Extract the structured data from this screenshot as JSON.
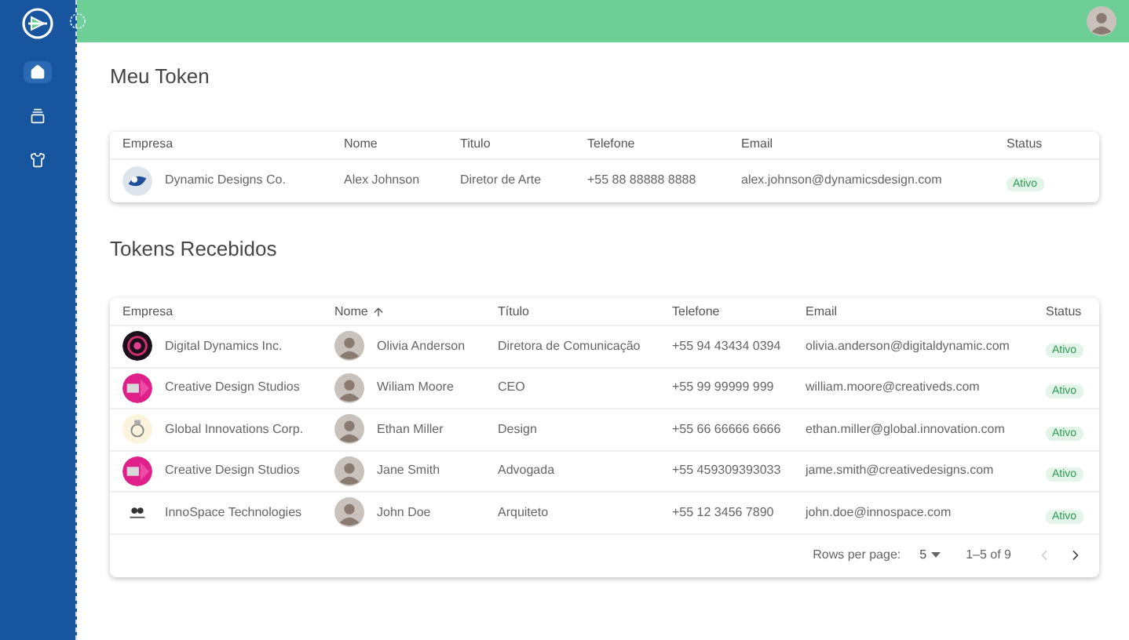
{
  "sidebar": {
    "items": [
      {
        "kind": "home",
        "selected": true
      },
      {
        "kind": "cards",
        "selected": false
      },
      {
        "kind": "shirt",
        "selected": false
      }
    ]
  },
  "my_token": {
    "title": "Meu Token",
    "columns": [
      "Empresa",
      "Nome",
      "Titulo",
      "Telefone",
      "Email",
      "Status"
    ],
    "rows": [
      {
        "company": "Dynamic Designs Co.",
        "name": "Alex Johnson",
        "title": "Diretor de Arte",
        "phone": "+55 88 88888 8888",
        "email": "alex.johnson@dynamicsdesign.com",
        "status": "Ativo"
      }
    ]
  },
  "received_tokens": {
    "title": "Tokens Recebidos",
    "columns": [
      {
        "label": "Empresa",
        "sorted": false
      },
      {
        "label": "Nome",
        "sorted": true
      },
      {
        "label": "Título",
        "sorted": false
      },
      {
        "label": "Telefone",
        "sorted": false
      },
      {
        "label": "Email",
        "sorted": false
      },
      {
        "label": "Status",
        "sorted": false
      }
    ],
    "rows": [
      {
        "company": "Digital Dynamics Inc.",
        "name": "Olivia Anderson",
        "title": "Diretora de Comunicação",
        "phone": "+55 94 43434 0394",
        "email": "olivia.anderson@digitaldynamic.com",
        "status": "Ativo"
      },
      {
        "company": "Creative Design Studios",
        "name": "Wiliam Moore",
        "title": "CEO",
        "phone": "+55 99 99999 999",
        "email": "william.moore@creativeds.com",
        "status": "Ativo"
      },
      {
        "company": "Global Innovations Corp.",
        "name": "Ethan Miller",
        "title": "Design",
        "phone": "+55 66 66666 6666",
        "email": "ethan.miller@global.innovation.com",
        "status": "Ativo"
      },
      {
        "company": "Creative Design Studios",
        "name": "Jane Smith",
        "title": "Advogada",
        "phone": "+55 459309393033",
        "email": "jame.smith@creativedesigns.com",
        "status": "Ativo"
      },
      {
        "company": "InnoSpace Technologies",
        "name": "John Doe",
        "title": "Arquiteto",
        "phone": "+55 12 3456 7890",
        "email": "john.doe@innospace.com",
        "status": "Ativo"
      }
    ],
    "pagination": {
      "rows_label": "Rows per page:",
      "rows_value": "5",
      "range": "1–5 of 9",
      "prev_disabled": true,
      "next_disabled": false
    }
  }
}
